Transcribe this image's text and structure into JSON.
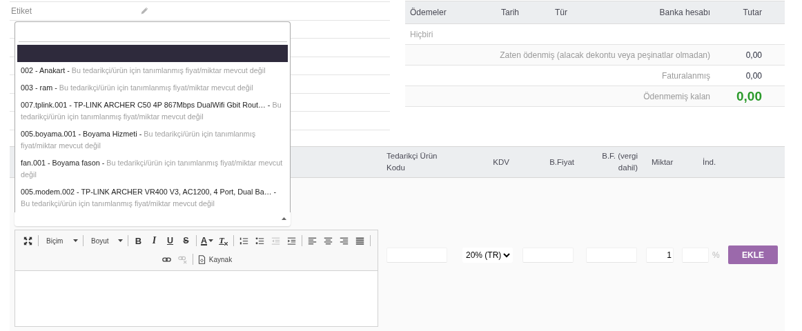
{
  "form_rows": [
    {
      "label": "Etiket",
      "editable": true
    },
    {
      "editable": false
    },
    {
      "editable": false
    },
    {
      "editable": false
    },
    {
      "editable": false
    },
    {
      "editable": false
    },
    {
      "editable": false
    }
  ],
  "payments": {
    "columns": [
      "Ödemeler",
      "Tarih",
      "Tür",
      "Banka hesabı",
      "Tutar"
    ],
    "empty_text": "Hiçbiri",
    "summary": [
      {
        "label": "Zaten ödenmiş (alacak dekontu veya peşinatlar olmadan)",
        "value": "0,00",
        "kind": "normal"
      },
      {
        "label": "Faturalanmış",
        "value": "0,00",
        "kind": "normal"
      },
      {
        "label": "Ödenmemiş kalan",
        "value": "0,00",
        "kind": "total"
      }
    ]
  },
  "product_picker": {
    "expanded": true,
    "options": [
      {
        "selected": true
      },
      {
        "label": "002 - Anakart -",
        "note": "Bu tedarikçi/ürün için tanımlanmış fiyat/miktar mevcut değil",
        "selected": false
      },
      {
        "label": "003 - ram -",
        "note": "Bu tedarikçi/ürün için tanımlanmış fiyat/miktar mevcut değil",
        "selected": false
      },
      {
        "label": "007.tplink.001 - TP-LINK ARCHER C50 4P 867Mbps DualWifi Gbit Rout… -",
        "note": "Bu tedarikçi/ürün için tanımlanmış fiyat/miktar mevcut değil",
        "selected": false
      },
      {
        "label": "005.boyama.001 - Boyama Hizmeti -",
        "note": "Bu tedarikçi/ürün için tanımlanmış fiyat/miktar mevcut değil",
        "selected": false
      },
      {
        "label": "fan.001 - Boyama fason -",
        "note": "Bu tedarikçi/ürün için tanımlanmış fiyat/miktar mevcut değil",
        "selected": false
      },
      {
        "label": "005.modem.002 - TP-LINK ARCHER VR400 V3, AC1200, 4 Port, Dual Ba… -",
        "note": "Bu tedarikçi/ürün için tanımlanmış fiyat/miktar mevcut değil",
        "selected": false
      }
    ]
  },
  "editor": {
    "toolbar": [
      {
        "groups": [
          {
            "buttons": [
              {
                "kind": "maximize",
                "disabled": false
              }
            ]
          },
          {
            "buttons": [
              {
                "kind": "combo",
                "text": "Biçim",
                "disabled": false
              }
            ]
          },
          {
            "buttons": [
              {
                "kind": "combo",
                "text": "Boyut",
                "disabled": false
              }
            ]
          },
          {
            "buttons": [
              {
                "kind": "bold",
                "text": "B",
                "disabled": false
              },
              {
                "kind": "italic",
                "text": "I",
                "disabled": false
              },
              {
                "kind": "underline",
                "text": "U",
                "disabled": false
              },
              {
                "kind": "strike",
                "text": "S",
                "disabled": false
              }
            ]
          },
          {
            "buttons": [
              {
                "kind": "color",
                "text": "A",
                "disabled": false
              },
              {
                "kind": "clear",
                "text": "T",
                "disabled": false
              }
            ]
          },
          {
            "buttons": [
              {
                "kind": "numbered",
                "disabled": false
              },
              {
                "kind": "bulleted",
                "disabled": false
              },
              {
                "kind": "outdent",
                "disabled": true
              },
              {
                "kind": "indent",
                "disabled": false
              }
            ]
          },
          {
            "buttons": [
              {
                "kind": "left",
                "disabled": false
              },
              {
                "kind": "center",
                "disabled": false
              },
              {
                "kind": "right",
                "disabled": false
              },
              {
                "kind": "justify",
                "disabled": false
              }
            ]
          }
        ]
      },
      {
        "groups": [
          {
            "buttons": [
              {
                "kind": "link",
                "disabled": false
              },
              {
                "kind": "unlink",
                "disabled": true
              }
            ]
          },
          {
            "buttons": [
              {
                "kind": "source",
                "text": "Kaynak",
                "disabled": false
              }
            ]
          }
        ]
      }
    ]
  },
  "lines": {
    "columns": [
      "Tedarikçi Ürün Kodu",
      "KDV",
      "B.Fiyat",
      "B.F. (vergi dahil)",
      "Miktar",
      "İnd."
    ],
    "new_line": {
      "vat": "20% (TR)",
      "quantity": "1",
      "discount_suffix": "%",
      "add_button": "EKLE"
    }
  }
}
